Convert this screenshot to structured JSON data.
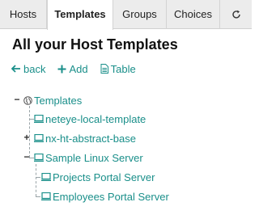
{
  "tabs": [
    {
      "label": "Hosts",
      "active": false
    },
    {
      "label": "Templates",
      "active": true
    },
    {
      "label": "Groups",
      "active": false
    },
    {
      "label": "Choices",
      "active": false
    }
  ],
  "refresh_icon": "refresh-icon",
  "page_title": "All your Host Templates",
  "actions": {
    "back": "back",
    "add": "Add",
    "table": "Table"
  },
  "tree": {
    "root": {
      "label": "Templates",
      "icon": "globe-icon",
      "expanded": true
    },
    "items": [
      {
        "label": "neteye-local-template",
        "icon": "monitor-icon"
      },
      {
        "label": "nx-ht-abstract-base",
        "icon": "monitor-icon",
        "expanded": false
      },
      {
        "label": "Sample Linux Server",
        "icon": "monitor-icon",
        "expanded": true,
        "children": [
          {
            "label": "Projects Portal Server",
            "icon": "monitor-icon"
          },
          {
            "label": "Employees Portal Server",
            "icon": "monitor-icon"
          }
        ]
      }
    ]
  },
  "colors": {
    "accent": "#1a8f8a",
    "tab_bar": "#ececec"
  }
}
